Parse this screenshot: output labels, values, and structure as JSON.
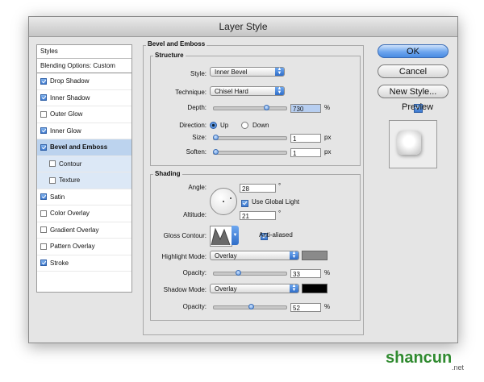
{
  "window": {
    "title": "Layer Style"
  },
  "styles_panel": {
    "header": "Styles",
    "blending_options": "Blending Options: Custom",
    "items": [
      {
        "label": "Drop Shadow",
        "checked": true
      },
      {
        "label": "Inner Shadow",
        "checked": true
      },
      {
        "label": "Outer Glow",
        "checked": false
      },
      {
        "label": "Inner Glow",
        "checked": true
      },
      {
        "label": "Bevel and Emboss",
        "checked": true,
        "selected": true
      },
      {
        "label": "Contour",
        "checked": false,
        "sub": true
      },
      {
        "label": "Texture",
        "checked": false,
        "sub": true
      },
      {
        "label": "Satin",
        "checked": true
      },
      {
        "label": "Color Overlay",
        "checked": false
      },
      {
        "label": "Gradient Overlay",
        "checked": false
      },
      {
        "label": "Pattern Overlay",
        "checked": false
      },
      {
        "label": "Stroke",
        "checked": true
      }
    ]
  },
  "bevel": {
    "title": "Bevel and Emboss",
    "structure": {
      "title": "Structure",
      "style_label": "Style:",
      "style_value": "Inner Bevel",
      "technique_label": "Technique:",
      "technique_value": "Chisel Hard",
      "depth_label": "Depth:",
      "depth_value": "730",
      "depth_unit": "%",
      "depth_slider": 0.75,
      "direction_label": "Direction:",
      "direction_up": "Up",
      "direction_down": "Down",
      "size_label": "Size:",
      "size_value": "1",
      "size_unit": "px",
      "size_slider": 0.0,
      "soften_label": "Soften:",
      "soften_value": "1",
      "soften_unit": "px",
      "soften_slider": 0.0
    },
    "shading": {
      "title": "Shading",
      "angle_label": "Angle:",
      "angle_value": "28",
      "angle_unit": "°",
      "global_light_label": "Use Global Light",
      "altitude_label": "Altitude:",
      "altitude_value": "21",
      "altitude_unit": "°",
      "gloss_contour_label": "Gloss Contour:",
      "anti_aliased_label": "Anti-aliased",
      "highlight_mode_label": "Highlight Mode:",
      "highlight_mode_value": "Overlay",
      "highlight_color": "#8a8a8a",
      "highlight_opacity_label": "Opacity:",
      "highlight_opacity_value": "33",
      "highlight_opacity_unit": "%",
      "highlight_opacity_slider": 0.33,
      "shadow_mode_label": "Shadow Mode:",
      "shadow_mode_value": "Overlay",
      "shadow_color": "#000000",
      "shadow_opacity_label": "Opacity:",
      "shadow_opacity_value": "52",
      "shadow_opacity_unit": "%",
      "shadow_opacity_slider": 0.52
    }
  },
  "buttons": {
    "ok": "OK",
    "cancel": "Cancel",
    "new_style": "New Style...",
    "preview": "Preview"
  },
  "watermark": {
    "text": "shancun",
    "sub": ".net"
  }
}
